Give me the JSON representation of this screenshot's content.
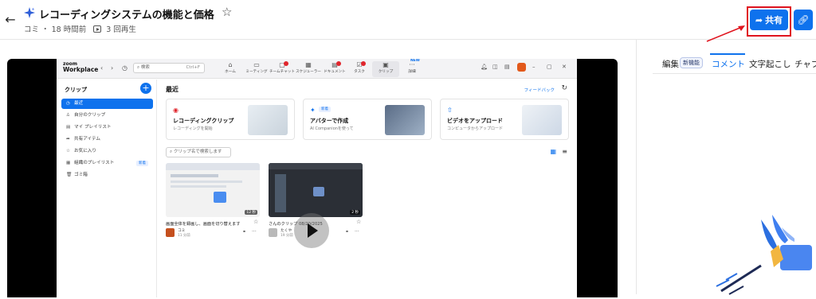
{
  "header": {
    "title": "レコーディングシステムの機能と価格",
    "owner": "コミ",
    "separator": "・",
    "time_ago": "18 時間前",
    "views": "3 回再生",
    "share_label": "共有"
  },
  "right_panel": {
    "tabs": [
      {
        "label": "編集",
        "badge": "新機能"
      },
      {
        "label": "コメント"
      },
      {
        "label": "文字起こし"
      },
      {
        "label": "チャプター"
      }
    ]
  },
  "zoom_app": {
    "logo_top": "zoom",
    "logo_bottom": "Workplace",
    "search_placeholder": "検索",
    "search_shortcut": "Ctrl+F",
    "nav": [
      {
        "label": "ホーム",
        "icon": "home-icon"
      },
      {
        "label": "ミーティング",
        "icon": "video-icon"
      },
      {
        "label": "チームチャット",
        "icon": "chat-icon"
      },
      {
        "label": "スケジューラー",
        "icon": "calendar-icon"
      },
      {
        "label": "ドキュメント",
        "icon": "document-icon"
      },
      {
        "label": "タスク",
        "icon": "task-icon"
      },
      {
        "label": "クリップ",
        "icon": "clip-icon"
      },
      {
        "label": "詳細",
        "icon": "more-icon"
      }
    ],
    "nav_new": "NEW",
    "sidebar": {
      "title": "クリップ",
      "items": [
        {
          "label": "最近",
          "icon": "clock-icon"
        },
        {
          "label": "自分のクリップ",
          "icon": "person-icon"
        },
        {
          "label": "マイ プレイリスト",
          "icon": "playlist-icon"
        },
        {
          "label": "共有アイテム",
          "icon": "share-icon"
        },
        {
          "label": "お気に入り",
          "icon": "star-icon"
        },
        {
          "label": "組織のプレイリスト",
          "icon": "org-playlist-icon",
          "tag": "新着"
        },
        {
          "label": "ゴミ箱",
          "icon": "trash-icon"
        }
      ]
    },
    "main": {
      "heading": "最近",
      "feedback": "フィードバック",
      "cards": [
        {
          "title": "レコーディングクリップ",
          "subtitle": "レコーディングを開始"
        },
        {
          "title": "アバターで作成",
          "subtitle": "AI Companionを使って",
          "tag": "新着"
        },
        {
          "title": "ビデオをアップロード",
          "subtitle": "コンピュータからアップロード"
        }
      ],
      "search_placeholder": "クリップ名で検索します",
      "videos": [
        {
          "title": "画面全体を録画し、画面を切り替えます",
          "owner": "コミ",
          "time": "11 分前",
          "duration": "12 秒"
        },
        {
          "title": "さんのクリップ 08/20/2025",
          "owner": "たくや",
          "time": "19 分前",
          "duration": "2 秒"
        }
      ]
    }
  },
  "colors": {
    "accent": "#0e72ed",
    "highlight": "#e0141e"
  }
}
